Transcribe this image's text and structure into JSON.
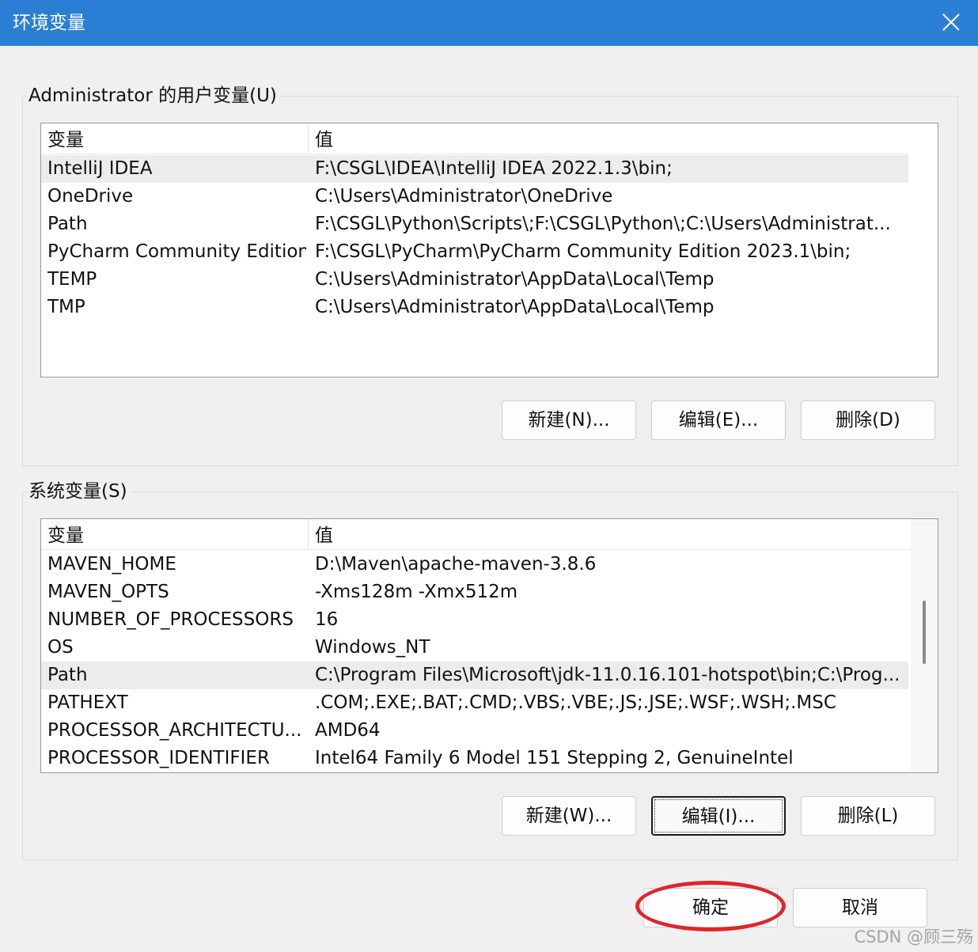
{
  "window": {
    "title": "环境变量",
    "close_glyph": "×"
  },
  "user_vars": {
    "group_label": "Administrator 的用户变量(U)",
    "columns": [
      "变量",
      "值"
    ],
    "rows": [
      {
        "name": "IntelliJ IDEA",
        "value": "F:\\CSGL\\IDEA\\IntelliJ IDEA 2022.1.3\\bin;",
        "selected": true
      },
      {
        "name": "OneDrive",
        "value": "C:\\Users\\Administrator\\OneDrive"
      },
      {
        "name": "Path",
        "value": "F:\\CSGL\\Python\\Scripts\\;F:\\CSGL\\Python\\;C:\\Users\\Administrat..."
      },
      {
        "name": "PyCharm Community Edition",
        "value": "F:\\CSGL\\PyCharm\\PyCharm Community Edition 2023.1\\bin;"
      },
      {
        "name": "TEMP",
        "value": "C:\\Users\\Administrator\\AppData\\Local\\Temp"
      },
      {
        "name": "TMP",
        "value": "C:\\Users\\Administrator\\AppData\\Local\\Temp"
      }
    ],
    "buttons": {
      "new": "新建(N)...",
      "edit": "编辑(E)...",
      "delete": "删除(D)"
    }
  },
  "system_vars": {
    "group_label": "系统变量(S)",
    "columns": [
      "变量",
      "值"
    ],
    "rows": [
      {
        "name": "MAVEN_HOME",
        "value": "D:\\Maven\\apache-maven-3.8.6"
      },
      {
        "name": "MAVEN_OPTS",
        "value": "-Xms128m -Xmx512m"
      },
      {
        "name": "NUMBER_OF_PROCESSORS",
        "value": "16"
      },
      {
        "name": "OS",
        "value": "Windows_NT"
      },
      {
        "name": "Path",
        "value": "C:\\Program Files\\Microsoft\\jdk-11.0.16.101-hotspot\\bin;C:\\Prog...",
        "selected": true
      },
      {
        "name": "PATHEXT",
        "value": ".COM;.EXE;.BAT;.CMD;.VBS;.VBE;.JS;.JSE;.WSF;.WSH;.MSC"
      },
      {
        "name": "PROCESSOR_ARCHITECTU...",
        "value": "AMD64"
      },
      {
        "name": "PROCESSOR_IDENTIFIER",
        "value": "Intel64 Family 6 Model 151 Stepping 2, GenuineIntel"
      }
    ],
    "buttons": {
      "new": "新建(W)...",
      "edit": "编辑(I)...",
      "delete": "删除(L)"
    }
  },
  "footer": {
    "ok": "确定",
    "cancel": "取消"
  },
  "watermark": "CSDN @顾三殇",
  "colors": {
    "titlebar": "#2a7fd4",
    "highlight_ring": "#e0252a"
  }
}
